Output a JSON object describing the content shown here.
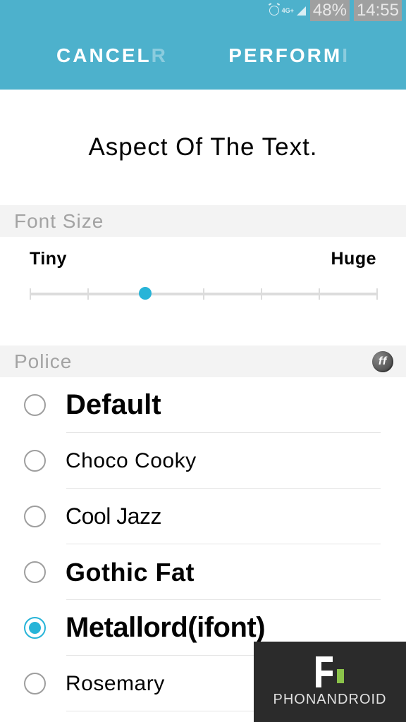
{
  "statusbar": {
    "network_label": "4G+",
    "battery_percent": "48%",
    "time": "14:55"
  },
  "header": {
    "cancel_label": "CANCEL",
    "cancel_ghost": "R",
    "perform_label": "PERFORM",
    "perform_ghost": "I"
  },
  "preview_text": "Aspect Of The Text.",
  "sections": {
    "font_size_label": "Font Size",
    "police_label": "Police"
  },
  "slider": {
    "min_label": "Tiny",
    "max_label": "Huge",
    "ticks": 7,
    "value_index": 2
  },
  "fonts": {
    "items": [
      {
        "label": "Default",
        "selected": false,
        "cls": "font-default"
      },
      {
        "label": "Choco Cooky",
        "selected": false,
        "cls": "font-choco"
      },
      {
        "label": "Cool Jazz",
        "selected": false,
        "cls": "font-cooljazz"
      },
      {
        "label": "Gothic Fat",
        "selected": false,
        "cls": "font-gothic"
      },
      {
        "label": "Metallord(ifont)",
        "selected": true,
        "cls": "font-metal"
      },
      {
        "label": "Rosemary",
        "selected": false,
        "cls": "font-rosemary"
      }
    ]
  },
  "watermark": {
    "brand": "PHONANDROID"
  }
}
